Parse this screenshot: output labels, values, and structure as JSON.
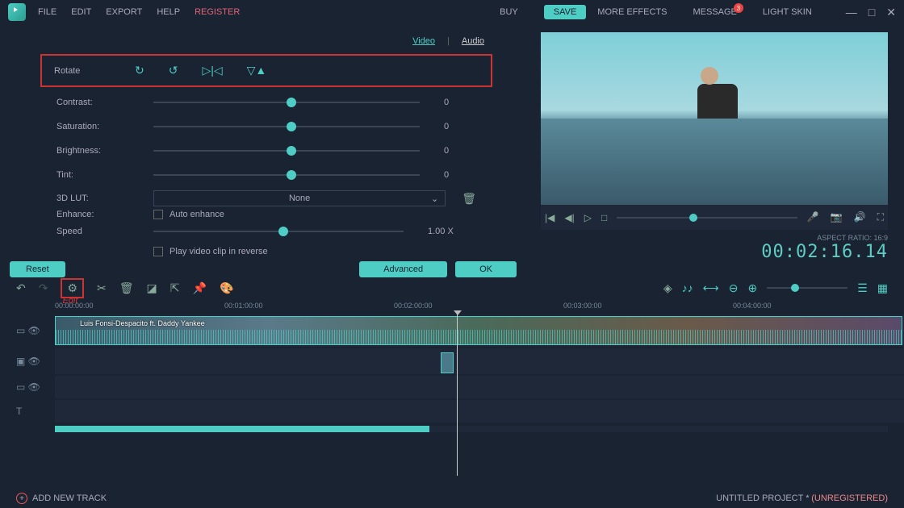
{
  "menu": {
    "file": "FILE",
    "edit": "EDIT",
    "export": "EXPORT",
    "help": "HELP",
    "register": "REGISTER",
    "buy": "BUY",
    "save": "SAVE",
    "more_effects": "MORE EFFECTS",
    "message": "MESSAGE",
    "message_badge": "3",
    "light_skin": "LIGHT SKIN"
  },
  "tabs": {
    "video": "Video",
    "audio": "Audio",
    "sep": "|"
  },
  "rotate": {
    "label": "Rotate"
  },
  "sliders": {
    "contrast": {
      "label": "Contrast:",
      "value": "0"
    },
    "saturation": {
      "label": "Saturation:",
      "value": "0"
    },
    "brightness": {
      "label": "Brightness:",
      "value": "0"
    },
    "tint": {
      "label": "Tint:",
      "value": "0"
    },
    "speed": {
      "label": "Speed",
      "value": "1.00 X"
    }
  },
  "lut": {
    "label": "3D LUT:",
    "value": "None"
  },
  "enhance": {
    "label": "Enhance:",
    "auto": "Auto enhance"
  },
  "reverse": {
    "label": "Play video clip in reverse"
  },
  "buttons": {
    "reset": "Reset",
    "advanced": "Advanced",
    "ok": "OK"
  },
  "preview": {
    "aspect": "ASPECT RATIO: 16:9",
    "time": "00:02:16.14"
  },
  "timeline": {
    "edit_label": "Edit",
    "times": [
      "00:00:00:00",
      "00:01:00:00",
      "00:02:00:00",
      "00:03:00:00",
      "00:04:00:00"
    ],
    "clip_name": "Luis Fonsi-Despacito ft. Daddy Yankee"
  },
  "footer": {
    "add_track": "ADD NEW TRACK",
    "project": "UNTITLED PROJECT *",
    "unreg": "(UNREGISTERED)"
  }
}
